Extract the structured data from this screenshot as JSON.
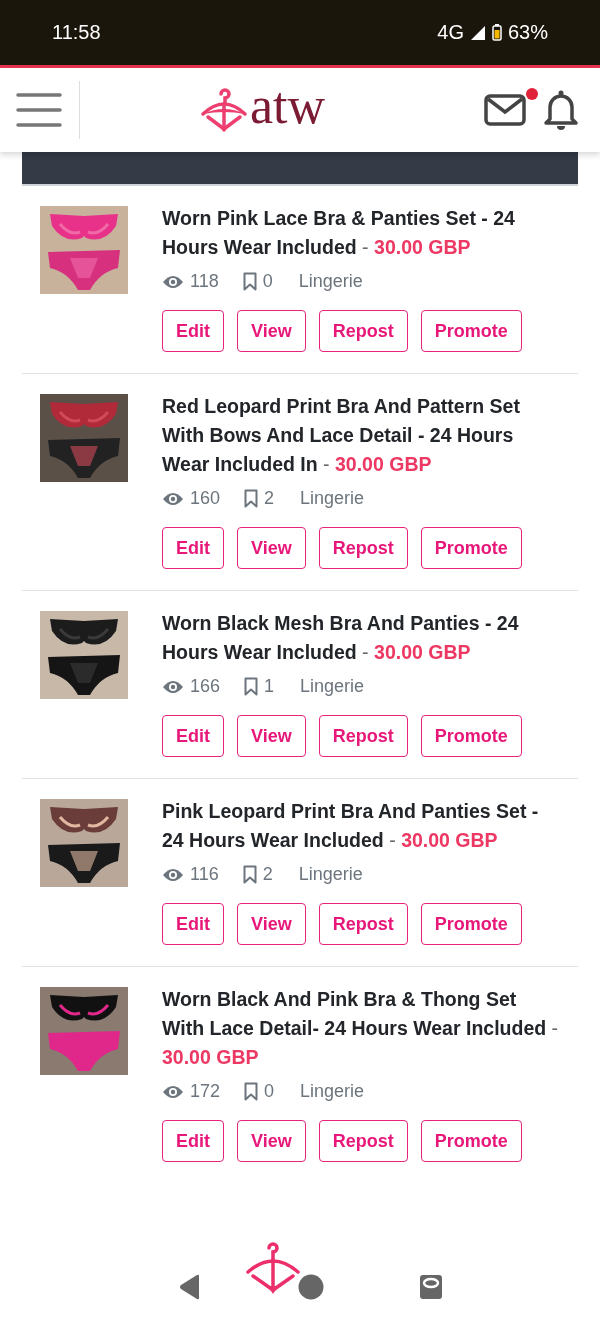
{
  "status_bar": {
    "time": "11:58",
    "network": "4G",
    "battery": "63%"
  },
  "header": {
    "logo_text": "atw",
    "mail_unread": true
  },
  "listings": [
    {
      "title": "Worn Pink Lace Bra & Panties Set - 24 Hours Wear Included",
      "separator": "-",
      "price": "30.00 GBP",
      "views": "118",
      "saves": "0",
      "category": "Lingerie",
      "actions": [
        "Edit",
        "View",
        "Repost",
        "Promote"
      ]
    },
    {
      "title": "Red Leopard Print Bra And Pattern Set With Bows And Lace Detail - 24 Hours Wear Included In",
      "separator": "-",
      "price": "30.00 GBP",
      "views": "160",
      "saves": "2",
      "category": "Lingerie",
      "actions": [
        "Edit",
        "View",
        "Repost",
        "Promote"
      ]
    },
    {
      "title": "Worn Black Mesh Bra And Panties - 24 Hours Wear Included",
      "separator": "-",
      "price": "30.00 GBP",
      "views": "166",
      "saves": "1",
      "category": "Lingerie",
      "actions": [
        "Edit",
        "View",
        "Repost",
        "Promote"
      ]
    },
    {
      "title": "Pink Leopard Print Bra And Panties Set - 24 Hours Wear Included",
      "separator": "-",
      "price": "30.00 GBP",
      "views": "116",
      "saves": "2",
      "category": "Lingerie",
      "actions": [
        "Edit",
        "View",
        "Repost",
        "Promote"
      ]
    },
    {
      "title": "Worn Black And Pink Bra & Thong Set With Lace Detail- 24 Hours Wear Included",
      "separator": "-",
      "price": "30.00 GBP",
      "views": "172",
      "saves": "0",
      "category": "Lingerie",
      "actions": [
        "Edit",
        "View",
        "Repost",
        "Promote"
      ]
    }
  ]
}
